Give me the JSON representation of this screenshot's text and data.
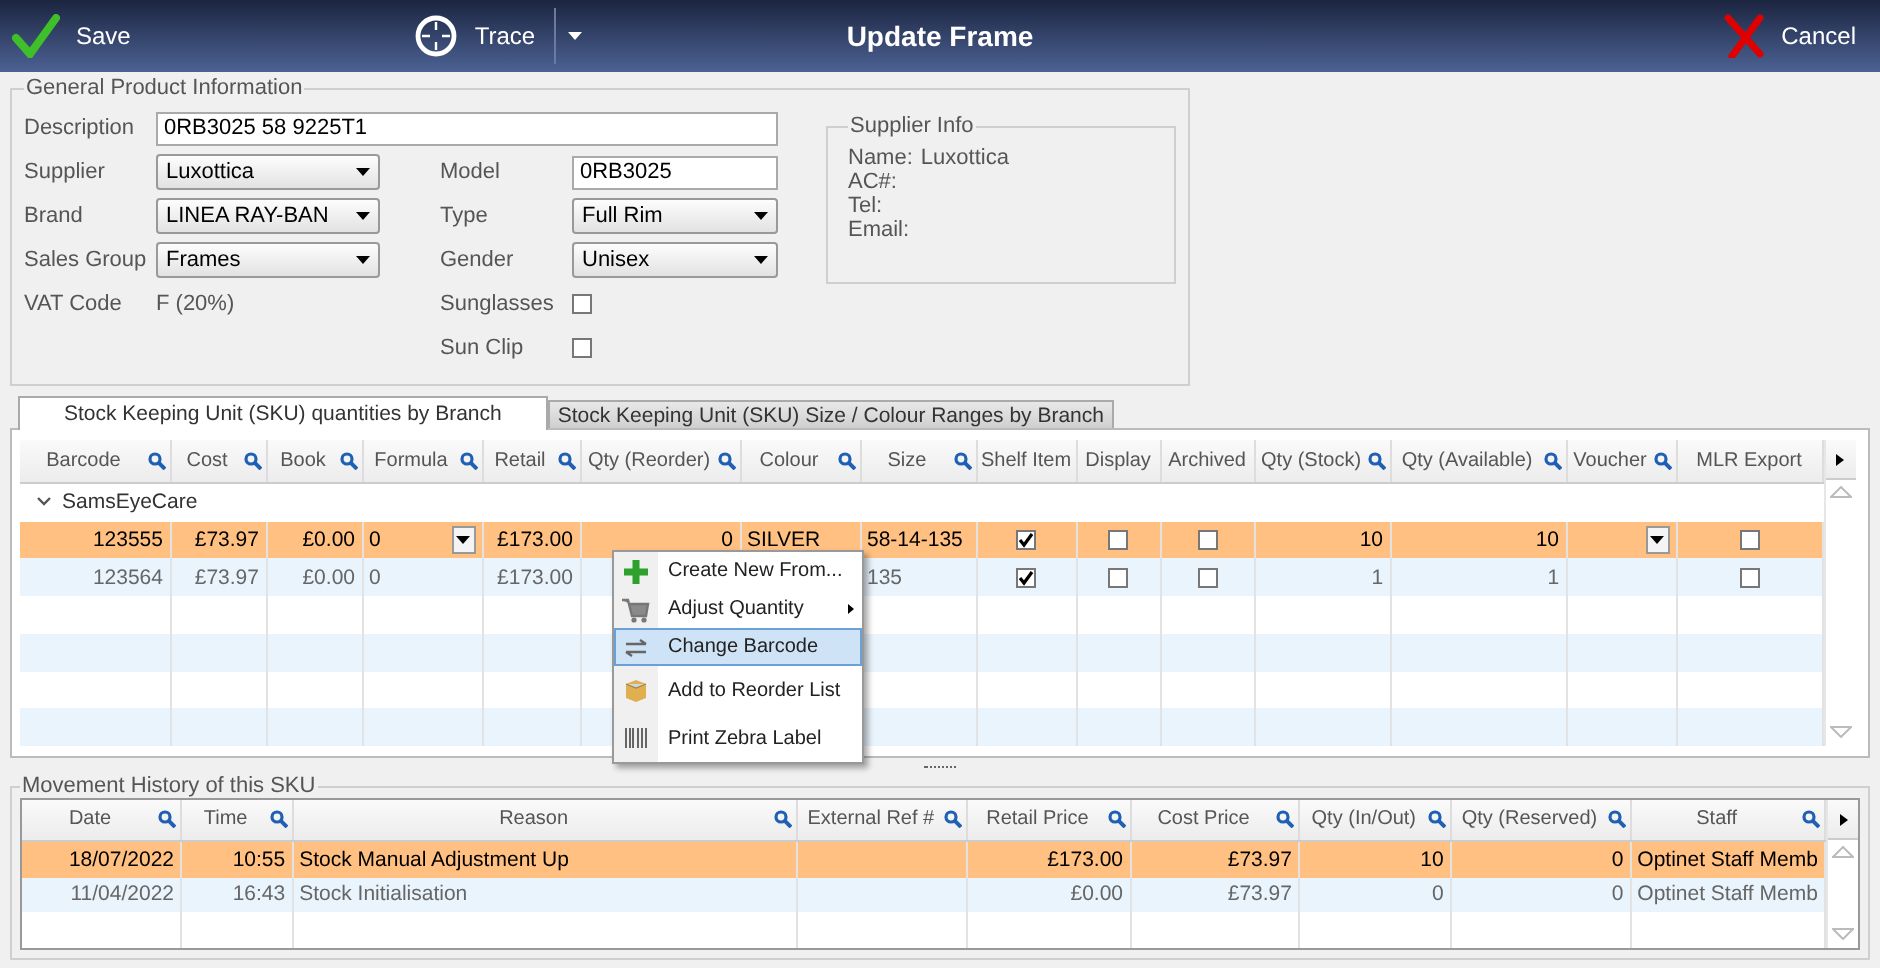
{
  "toolbar": {
    "save": "Save",
    "trace": "Trace",
    "title": "Update Frame",
    "cancel": "Cancel"
  },
  "general": {
    "legend": "General Product Information",
    "description": {
      "label": "Description",
      "value": "0RB3025 58 9225T1"
    },
    "left_fields": [
      {
        "kind": "select",
        "label": "Supplier",
        "value": "Luxottica"
      },
      {
        "kind": "select",
        "label": "Brand",
        "value": "LINEA RAY-BAN"
      },
      {
        "kind": "select",
        "label": "Sales Group",
        "value": "Frames"
      },
      {
        "kind": "static",
        "label": "VAT Code",
        "value": "F (20%)"
      }
    ],
    "right_fields": [
      {
        "kind": "input",
        "label": "Model",
        "value": "0RB3025"
      },
      {
        "kind": "select",
        "label": "Type",
        "value": "Full Rim"
      },
      {
        "kind": "select",
        "label": "Gender",
        "value": "Unisex"
      },
      {
        "kind": "check",
        "label": "Sunglasses",
        "checked": false
      },
      {
        "kind": "check",
        "label": "Sun Clip",
        "checked": false
      }
    ]
  },
  "supplier_info": {
    "legend": "Supplier Info",
    "lines": [
      {
        "label": "Name:",
        "value": "Luxottica"
      },
      {
        "label": "AC#:"
      },
      {
        "label": "Tel:"
      },
      {
        "label": "Email:"
      }
    ]
  },
  "tabs": [
    {
      "label": "Stock Keeping Unit (SKU) quantities by Branch",
      "selected": true
    },
    {
      "label": "Stock Keeping Unit (SKU) Size / Colour Ranges by Branch",
      "selected": false
    }
  ],
  "sku_grid": {
    "columns": [
      {
        "label": "Barcode",
        "kind": "number",
        "search": true
      },
      {
        "label": "Cost",
        "kind": "number",
        "search": true
      },
      {
        "label": "Book",
        "kind": "number",
        "search": true
      },
      {
        "label": "Formula",
        "kind": "text",
        "search": true,
        "dropdown": true
      },
      {
        "label": "Retail",
        "kind": "number",
        "search": true
      },
      {
        "label": "Qty (Reorder)",
        "kind": "number",
        "search": true
      },
      {
        "label": "Colour",
        "kind": "text",
        "search": true
      },
      {
        "label": "Size",
        "kind": "text",
        "search": true
      },
      {
        "label": "Shelf Item",
        "kind": "check",
        "search": false
      },
      {
        "label": "Display",
        "kind": "check",
        "search": false
      },
      {
        "label": "Archived",
        "kind": "check",
        "search": false
      },
      {
        "label": "Qty (Stock)",
        "kind": "number",
        "search": true
      },
      {
        "label": "Qty (Available)",
        "kind": "number",
        "search": true
      },
      {
        "label": "Voucher",
        "kind": "text",
        "search": true,
        "dropdown": true
      },
      {
        "label": "MLR Export",
        "kind": "check",
        "search": false
      }
    ],
    "group": {
      "label": "SamsEyeCare",
      "expanded": true
    },
    "rows": [
      {
        "selected": true,
        "cells": [
          "123555",
          "£73.97",
          "£0.00",
          "0",
          "£173.00",
          "0",
          "SILVER",
          "58-14-135",
          true,
          false,
          false,
          "10",
          "10",
          null,
          false
        ]
      },
      {
        "selected": false,
        "cells": [
          "123564",
          "£73.97",
          "£0.00",
          "0",
          "£173.00",
          null,
          null,
          "135",
          true,
          false,
          false,
          "1",
          "1",
          null,
          false
        ]
      }
    ]
  },
  "context_menu": [
    {
      "kind": "plus",
      "label": "Create New From...",
      "submenu": false,
      "selected": false
    },
    {
      "kind": "cart",
      "label": "Adjust Quantity",
      "submenu": true,
      "selected": false
    },
    {
      "kind": "swap",
      "label": "Change Barcode",
      "submenu": false,
      "selected": true
    },
    {
      "kind": "box",
      "label": "Add to Reorder List",
      "submenu": false,
      "selected": false
    },
    {
      "kind": "barcode",
      "label": "Print Zebra Label",
      "submenu": false,
      "selected": false
    }
  ],
  "movement": {
    "legend": "Movement History of this SKU",
    "columns": [
      {
        "label": "Date",
        "kind": "number",
        "search": true
      },
      {
        "label": "Time",
        "kind": "number",
        "search": true
      },
      {
        "label": "Reason",
        "kind": "text",
        "search": true
      },
      {
        "label": "External Ref #",
        "kind": "text",
        "search": true
      },
      {
        "label": "Retail Price",
        "kind": "number",
        "search": true
      },
      {
        "label": "Cost Price",
        "kind": "number",
        "search": true
      },
      {
        "label": "Qty (In/Out)",
        "kind": "number",
        "search": true
      },
      {
        "label": "Qty (Reserved)",
        "kind": "number",
        "search": true
      },
      {
        "label": "Staff",
        "kind": "text",
        "search": true
      }
    ],
    "rows": [
      {
        "selected": true,
        "cells": [
          "18/07/2022",
          "10:55",
          "Stock Manual Adjustment Up",
          null,
          "£173.00",
          "£73.97",
          "10",
          "0",
          "Optinet Staff Memb"
        ]
      },
      {
        "selected": false,
        "cells": [
          "11/04/2022",
          "16:43",
          "Stock Initialisation",
          null,
          "£0.00",
          "£73.97",
          "0",
          "0",
          "Optinet Staff Memb"
        ]
      }
    ]
  }
}
